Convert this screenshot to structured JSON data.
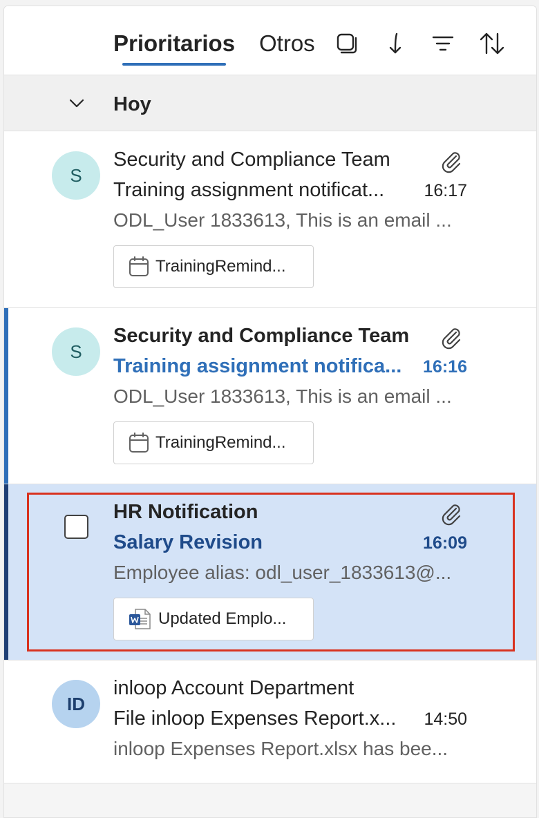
{
  "header": {
    "tab_focused": "Prioritarios",
    "tab_other": "Otros",
    "icons": [
      "select-all-icon",
      "jump-down-icon",
      "filter-icon",
      "sort-icon"
    ]
  },
  "group": {
    "label": "Hoy"
  },
  "messages": [
    {
      "avatar": "S",
      "sender": "Security and Compliance Team",
      "subject": "Training assignment notificat...",
      "time": "16:17",
      "preview": "ODL_User 1833613, This is an email ...",
      "attachment": "TrainingRemind...",
      "attachment_icon": "calendar-icon",
      "unread": false
    },
    {
      "avatar": "S",
      "sender": "Security and Compliance Team",
      "subject": "Training assignment notifica...",
      "time": "16:16",
      "preview": "ODL_User 1833613, This is an email ...",
      "attachment": "TrainingRemind...",
      "attachment_icon": "calendar-icon",
      "unread": true
    },
    {
      "avatar": "",
      "sender": "HR Notification",
      "subject": "Salary Revision",
      "time": "16:09",
      "preview": "Employee alias: odl_user_1833613@...",
      "attachment": "Updated Emplo...",
      "attachment_icon": "word-doc-icon",
      "selected": true
    },
    {
      "avatar": "ID",
      "sender": "inloop Account Department",
      "subject": "File inloop Expenses Report.x...",
      "time": "14:50",
      "preview": "inloop Expenses Report.xlsx has bee...",
      "unread": false
    }
  ],
  "colors": {
    "accent": "#2f6fb8",
    "selected_bg": "#d4e3f7",
    "highlight_border": "#d9321f"
  }
}
